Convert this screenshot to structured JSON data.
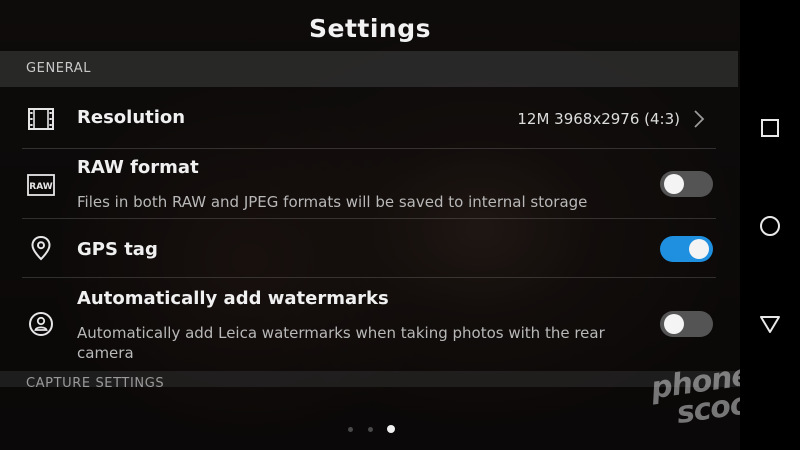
{
  "header": {
    "title": "Settings"
  },
  "sections": [
    {
      "label": "GENERAL"
    },
    {
      "label": "CAPTURE SETTINGS"
    }
  ],
  "settings": {
    "resolution": {
      "label": "Resolution",
      "value": "12M 3968x2976 (4:3)",
      "icon": "film-icon"
    },
    "raw": {
      "label": "RAW format",
      "description": "Files in both RAW and JPEG formats will be saved to internal storage",
      "icon": "raw-icon",
      "icon_text": "RAW",
      "enabled": false
    },
    "gps": {
      "label": "GPS tag",
      "icon": "location-pin-icon",
      "enabled": true
    },
    "watermark": {
      "label": "Automatically add watermarks",
      "description": "Automatically add Leica watermarks when taking photos with the rear camera",
      "icon": "watermark-icon",
      "enabled": false
    }
  },
  "pager": {
    "count": 3,
    "active": 3
  },
  "navigation": {
    "recents": "square-icon",
    "home": "circle-icon",
    "back": "triangle-icon"
  },
  "brand_watermark": {
    "line1": "phone",
    "line2": "scoop"
  },
  "colors": {
    "toggle_on": "#1f8fe0",
    "toggle_off": "#555454"
  }
}
